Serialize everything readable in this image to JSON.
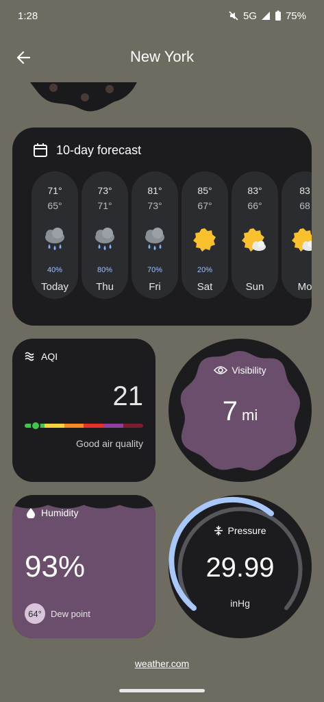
{
  "status": {
    "time": "1:28",
    "network": "5G",
    "battery": "75%"
  },
  "header": {
    "title": "New York"
  },
  "forecast": {
    "title": "10-day forecast",
    "days": [
      {
        "name": "Today",
        "high": "71°",
        "low": "65°",
        "precip": "40%",
        "icon": "rain-cloud-icon"
      },
      {
        "name": "Thu",
        "high": "73°",
        "low": "71°",
        "precip": "80%",
        "icon": "rain-cloud-icon"
      },
      {
        "name": "Fri",
        "high": "81°",
        "low": "73°",
        "precip": "70%",
        "icon": "rain-cloud-icon"
      },
      {
        "name": "Sat",
        "high": "85°",
        "low": "67°",
        "precip": "20%",
        "icon": "sun-icon"
      },
      {
        "name": "Sun",
        "high": "83°",
        "low": "66°",
        "precip": "",
        "icon": "partly-cloudy-icon"
      },
      {
        "name": "Mo",
        "high": "83",
        "low": "68",
        "precip": "",
        "icon": "partly-cloudy-icon"
      }
    ]
  },
  "aqi": {
    "title": "AQI",
    "value": "21",
    "level": 0.09,
    "description": "Good air quality"
  },
  "visibility": {
    "title": "Visibility",
    "value": "7",
    "unit": "mi"
  },
  "humidity": {
    "title": "Humidity",
    "value": "93%",
    "level": 0.93,
    "dew_point_value": "64°",
    "dew_point_label": "Dew point"
  },
  "pressure": {
    "title": "Pressure",
    "value": "29.99",
    "unit": "inHg"
  },
  "footer": {
    "source": "weather.com"
  },
  "colors": {
    "card": "#1c1c1f",
    "accent_purple": "#6a4e6b",
    "gauge_blue": "#a8c7fa"
  }
}
